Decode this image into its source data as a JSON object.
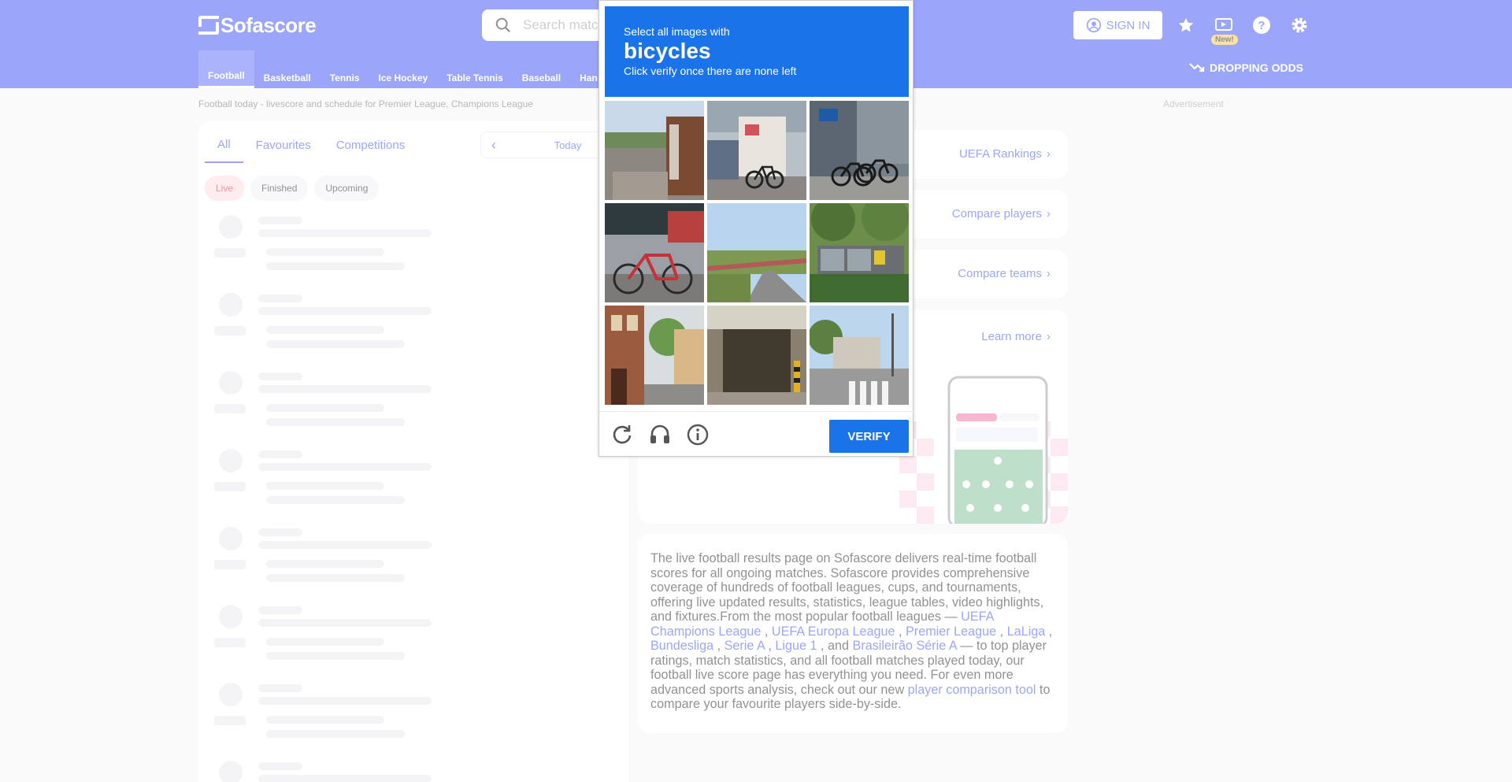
{
  "header": {
    "logo_text": "Sofascore",
    "search_placeholder": "Search matches, competitions, teams, players, and more",
    "signin_label": "SIGN IN",
    "new_badge": "New!",
    "sport_tabs": [
      "Football",
      "Basketball",
      "Tennis",
      "Ice Hockey",
      "Table Tennis",
      "Baseball",
      "Han"
    ],
    "dropping_odds": "DROPPING ODDS"
  },
  "page": {
    "breadcrumb": "Football today - livescore and schedule for Premier League, Champions League",
    "advertisement": "Advertisement",
    "tabs": [
      "All",
      "Favourites",
      "Competitions"
    ],
    "date_label": "Today",
    "filters": [
      "Live",
      "Finished",
      "Upcoming"
    ]
  },
  "right": {
    "uefa_rankings": "UEFA Rankings",
    "compare_players": "Compare players",
    "compare_teams": "Compare teams",
    "learn_more": "Learn more"
  },
  "description": {
    "intro": "The live football results page on Sofascore delivers real-time football scores for all ongoing matches. Sofascore provides comprehensive coverage of hundreds of football leagues, cups, and tournaments, offering live updated results, statistics, league tables, video highlights, and fixtures.From the most popular football leagues — ",
    "links": [
      "UEFA Champions League",
      "UEFA Europa League",
      "Premier League",
      "LaLiga",
      "Bundesliga",
      "Serie A",
      "Ligue 1",
      "Brasileirão Série A"
    ],
    "sep_comma": " , ",
    "sep_and": " , and ",
    "after_links": " — to top player ratings, match statistics, and all football matches played today, our football live score page has everything you need. For even more advanced sports analysis, check out our new ",
    "tool_link": "player comparison tool",
    "outro": " to compare your favourite players side-by-side."
  },
  "captcha": {
    "line1": "Select all images with",
    "target": "bicycles",
    "line3": "Click verify once there are none left",
    "verify_label": "VERIFY",
    "tiles": [
      {
        "name": "bus-stop-street"
      },
      {
        "name": "bicycle-by-kiosk"
      },
      {
        "name": "bicycles-parked"
      },
      {
        "name": "red-bicycle"
      },
      {
        "name": "road-overpass"
      },
      {
        "name": "bus-shelter-trees"
      },
      {
        "name": "building-street"
      },
      {
        "name": "garage-entrance"
      },
      {
        "name": "crosswalk-street"
      }
    ]
  },
  "colors": {
    "brand": "#374df5",
    "captcha_blue": "#1a73e8",
    "live": "#d92534"
  }
}
